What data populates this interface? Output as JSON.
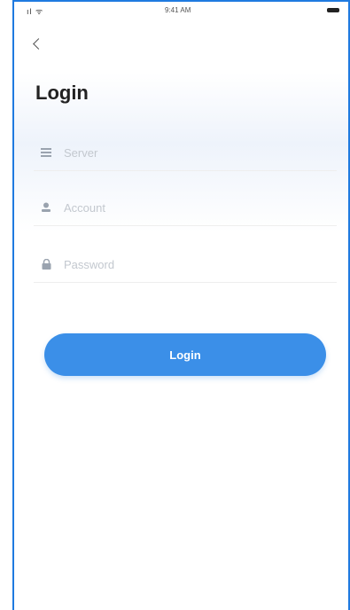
{
  "status_bar": {
    "signal": "ıl ᯤ",
    "time": "9:41 AM"
  },
  "header": {
    "back_icon": "chevron-left-icon",
    "title": "Login"
  },
  "form": {
    "server": {
      "placeholder": "Server",
      "value": "",
      "icon": "server-icon"
    },
    "account": {
      "placeholder": "Account",
      "value": "",
      "icon": "user-icon"
    },
    "password": {
      "placeholder": "Password",
      "value": "",
      "icon": "lock-icon"
    }
  },
  "actions": {
    "login_label": "Login"
  },
  "colors": {
    "accent": "#3b8fe8",
    "frame": "#1f7ae0"
  }
}
